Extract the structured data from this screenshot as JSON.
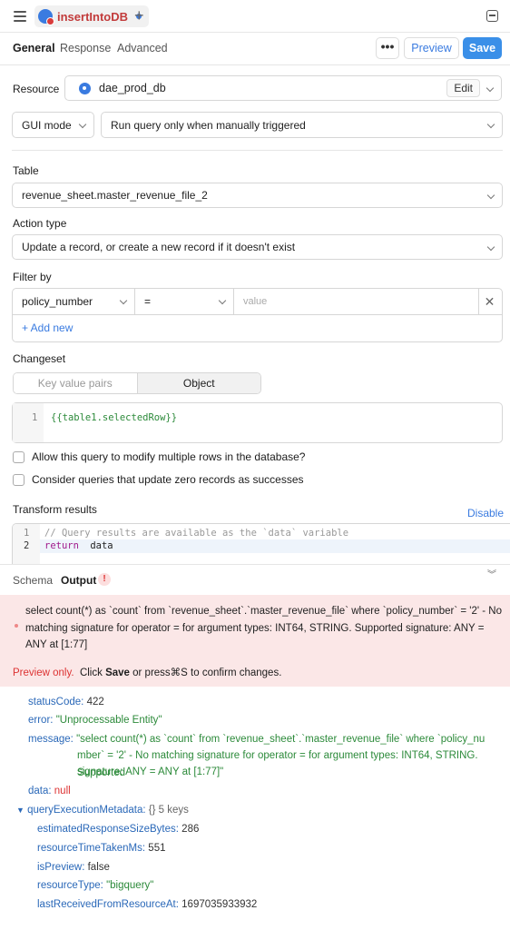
{
  "topbar": {
    "query_name": "insertIntoDB",
    "icons": [
      "hamburger-icon",
      "bigquery-icon",
      "plus-icon",
      "collapse-panel-icon"
    ]
  },
  "tabs": {
    "general": "General",
    "response": "Response",
    "advanced": "Advanced",
    "more": "•••",
    "preview": "Preview",
    "save": "Save"
  },
  "resource": {
    "label": "Resource",
    "value": "dae_prod_db",
    "edit": "Edit"
  },
  "mode": {
    "gui": "GUI mode",
    "trigger": "Run query only when manually triggered"
  },
  "table": {
    "label": "Table",
    "value": "revenue_sheet.master_revenue_file_2"
  },
  "action": {
    "label": "Action type",
    "value": "Update a record, or create a new record if it doesn't exist"
  },
  "filter": {
    "label": "Filter by",
    "column": "policy_number",
    "operator": "=",
    "value_placeholder": "value",
    "add_new": "+ Add new"
  },
  "changeset": {
    "label": "Changeset",
    "tab_kv": "Key value pairs",
    "tab_object": "Object",
    "line_no": "1",
    "code": "{{table1.selectedRow}}"
  },
  "options": {
    "multi_rows": "Allow this query to modify multiple rows in the database?",
    "zero_records": "Consider queries that update zero records as successes"
  },
  "transform": {
    "label": "Transform results",
    "disable": "Disable",
    "line1_no": "1",
    "line1": "// Query results are available as the `data` variable",
    "line2_no": "2",
    "line2_kw": "return",
    "line2_rest": " data"
  },
  "panel": {
    "schema": "Schema",
    "output": "Output",
    "badge": "!"
  },
  "error": {
    "message": "select count(*) as `count` from `revenue_sheet`.`master_revenue_file` where `policy_number` = '2' - No matching signature for operator = for argument types: INT64, STRING. Supported signature: ANY = ANY at [1:77]",
    "preview_only": "Preview only.",
    "click": "Click",
    "save": "Save",
    "press": "or press⌘S to confirm changes."
  },
  "output": {
    "statusCode_key": "statusCode:",
    "statusCode_val": "422",
    "error_key": "error:",
    "error_val": "\"Unprocessable Entity\"",
    "message_key": "message:",
    "message_val_line1": "\"select count(*) as `count` from `revenue_sheet`.`master_revenue_file` where `policy_nu",
    "message_val_line2": "mber` = '2' - No matching signature for operator = for argument types: INT64, STRING. Supported",
    "message_val_line3": "signature: ANY = ANY at [1:77]\"",
    "data_key": "data:",
    "data_val": "null",
    "meta_key": "queryExecutionMetadata:",
    "meta_summary": "{} 5 keys",
    "est_key": "estimatedResponseSizeBytes:",
    "est_val": "286",
    "time_key": "resourceTimeTakenMs:",
    "time_val": "551",
    "preview_key": "isPreview:",
    "preview_val": "false",
    "type_key": "resourceType:",
    "type_val": "\"bigquery\"",
    "last_key": "lastReceivedFromResourceAt:",
    "last_val": "1697035933932"
  }
}
